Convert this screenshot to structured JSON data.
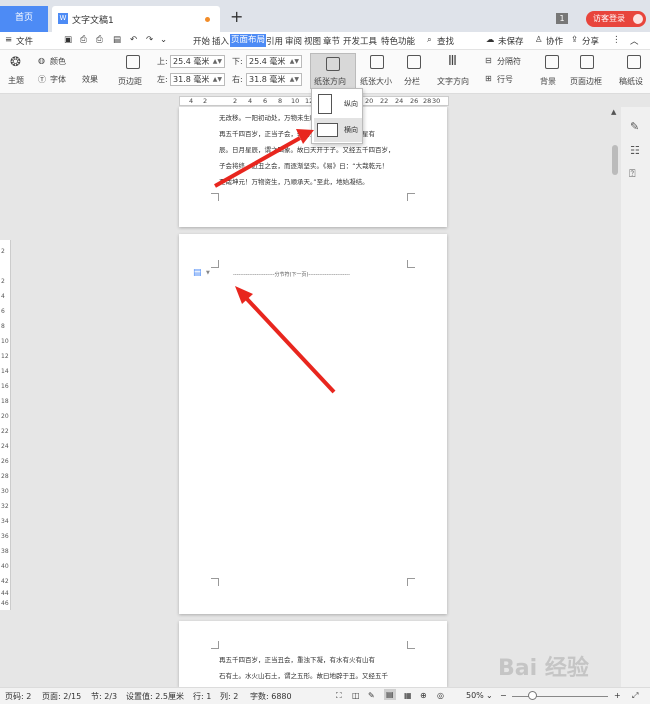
{
  "tabbar": {
    "home_tab": "首页",
    "doc_tab": "文字文稿1",
    "new_tab": "+",
    "page_count_badge": "1",
    "visitor_login": "访客登录"
  },
  "menubar": {
    "file_menu": "文件",
    "items": [
      "开始",
      "插入",
      "页面布局",
      "引用",
      "审阅",
      "视图",
      "章节",
      "开发工具",
      "特色功能"
    ],
    "search": "查找",
    "unsaved": "未保存",
    "collaborate": "协作",
    "share": "分享"
  },
  "ribbon": {
    "theme": "主题",
    "colors": "颜色",
    "fonts": "字体",
    "effects": "效果",
    "margins": "页边距",
    "margin_top_label": "上:",
    "margin_top_value": "25.4 毫米",
    "margin_bottom_label": "下:",
    "margin_bottom_value": "25.4 毫米",
    "margin_left_label": "左:",
    "margin_left_value": "31.8 毫米",
    "margin_right_label": "右:",
    "margin_right_value": "31.8 毫米",
    "orientation": "纸张方向",
    "paper_size": "纸张大小",
    "columns": "分栏",
    "text_direction": "文字方向",
    "breaks": "分隔符",
    "line_numbers": "行号",
    "background": "背景",
    "page_border": "页面边框",
    "draft_paper": "稿纸设"
  },
  "orientation_menu": {
    "portrait": "纵向",
    "landscape": "横向"
  },
  "ruler": {
    "numbers": [
      "4",
      "2",
      "2",
      "4",
      "6",
      "8",
      "10",
      "12",
      "14",
      "16",
      "18",
      "20",
      "22",
      "24",
      "26",
      "28",
      "30"
    ]
  },
  "vruler": {
    "numbers": [
      "2",
      "2",
      "4",
      "6",
      "8",
      "10",
      "12",
      "14",
      "16",
      "18",
      "20",
      "22",
      "24",
      "26",
      "28",
      "30",
      "32",
      "34",
      "36",
      "38",
      "40",
      "42",
      "44",
      "46"
    ]
  },
  "page1": {
    "lines": [
      "无改移。一阳初动处，万物未生时。 地有粮。。",
      "    再五千四百岁，正当子会，轻清上腾，有日有月有星有",
      "辰。日月星辰，谓之四象。故曰天开于子。又经五千四百岁，",
      "子会将终，近丑之会，而逐渐坚实。《易》曰：“大哉乾元！",
      "至哉坤元！万物资生，乃顺承天。”至此，地始凝结。"
    ]
  },
  "page2": {
    "header_line": "-----------------------分节符(下一页)-----------------------"
  },
  "page3": {
    "lines": [
      "    再五千四百岁，正当丑会，重浊下凝，有水有火有山有",
      "石有土。水火山石土，谓之五形。故曰地辟于丑。又经五千"
    ]
  },
  "statusbar": {
    "page_no": "页码: 2",
    "pages": "页面: 2/15",
    "section": "节: 2/3",
    "setting": "设置值: 2.5厘米",
    "row": "行: 1",
    "col": "列: 2",
    "word_count": "字数: 6880",
    "zoom": "50%"
  },
  "watermark": "Bai 经验"
}
